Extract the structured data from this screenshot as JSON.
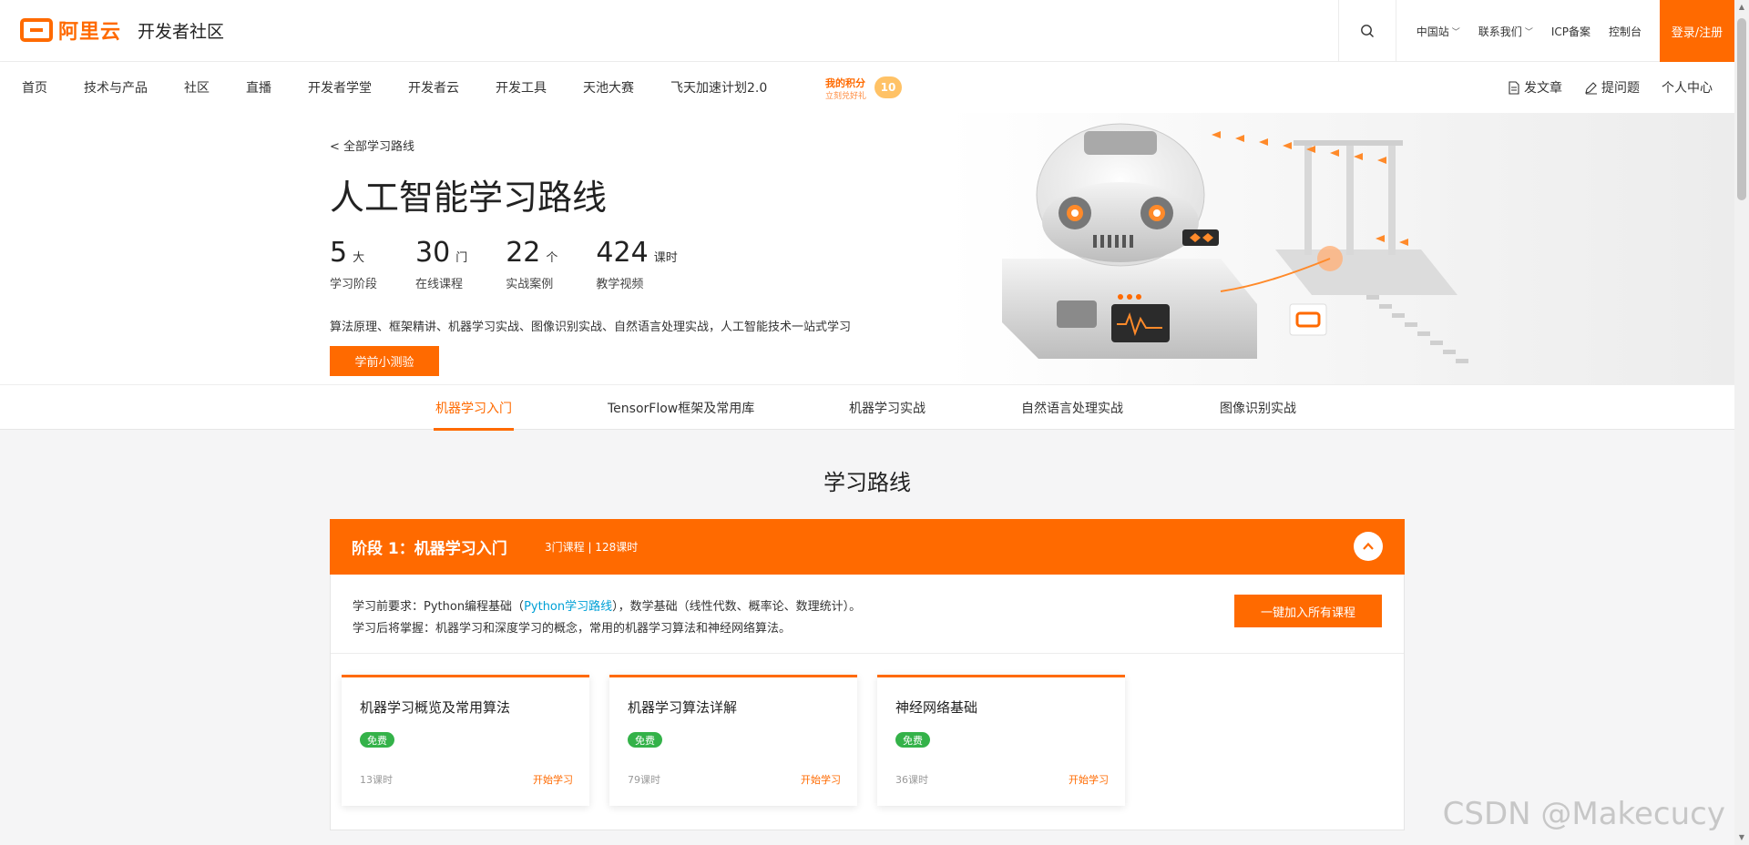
{
  "header": {
    "brand": "阿里云",
    "site": "开发者社区",
    "links": [
      {
        "label": "中国站",
        "dropdown": true
      },
      {
        "label": "联系我们",
        "dropdown": true
      },
      {
        "label": "ICP备案",
        "dropdown": false
      },
      {
        "label": "控制台",
        "dropdown": false
      }
    ],
    "login": "登录/注册"
  },
  "nav": {
    "items": [
      "首页",
      "技术与产品",
      "社区",
      "直播",
      "开发者学堂",
      "开发者云",
      "开发工具",
      "天池大赛",
      "飞天加速计划2.0"
    ],
    "points": {
      "title": "我的积分",
      "subtitle": "立刻兑好礼",
      "value": "10"
    },
    "right": {
      "write": "发文章",
      "ask": "提问题",
      "profile": "个人中心"
    }
  },
  "hero": {
    "back": "< 全部学习路线",
    "title": "人工智能学习路线",
    "stats": [
      {
        "num": "5",
        "unit": "大",
        "label": "学习阶段"
      },
      {
        "num": "30",
        "unit": "门",
        "label": "在线课程"
      },
      {
        "num": "22",
        "unit": "个",
        "label": "实战案例"
      },
      {
        "num": "424",
        "unit": "课时",
        "label": "教学视频"
      }
    ],
    "desc": "算法原理、框架精讲、机器学习实战、图像识别实战、自然语言处理实战，人工智能技术一站式学习",
    "quiz": "学前小测验"
  },
  "tabs": [
    "机器学习入门",
    "TensorFlow框架及常用库",
    "机器学习实战",
    "自然语言处理实战",
    "图像识别实战"
  ],
  "main": {
    "section_title": "学习路线",
    "stage": {
      "name": "阶段 1：机器学习入门",
      "meta": "3门课程 | 128课时",
      "req_prefix": "学习前要求：Python编程基础（",
      "req_link": "Python学习路线",
      "req_suffix": "），数学基础（线性代数、概率论、数理统计）。",
      "outcome": "学习后将掌握：机器学习和深度学习的概念，常用的机器学习算法和神经网络算法。",
      "join": "一键加入所有课程"
    },
    "courses": [
      {
        "title": "机器学习概览及常用算法",
        "tag": "免费",
        "hours": "13课时",
        "start": "开始学习"
      },
      {
        "title": "机器学习算法详解",
        "tag": "免费",
        "hours": "79课时",
        "start": "开始学习"
      },
      {
        "title": "神经网络基础",
        "tag": "免费",
        "hours": "36课时",
        "start": "开始学习"
      }
    ]
  },
  "watermark": "CSDN @Makecucy",
  "colors": {
    "accent": "#ff6a00",
    "free_tag": "#34b249",
    "link": "#00a0d6"
  }
}
